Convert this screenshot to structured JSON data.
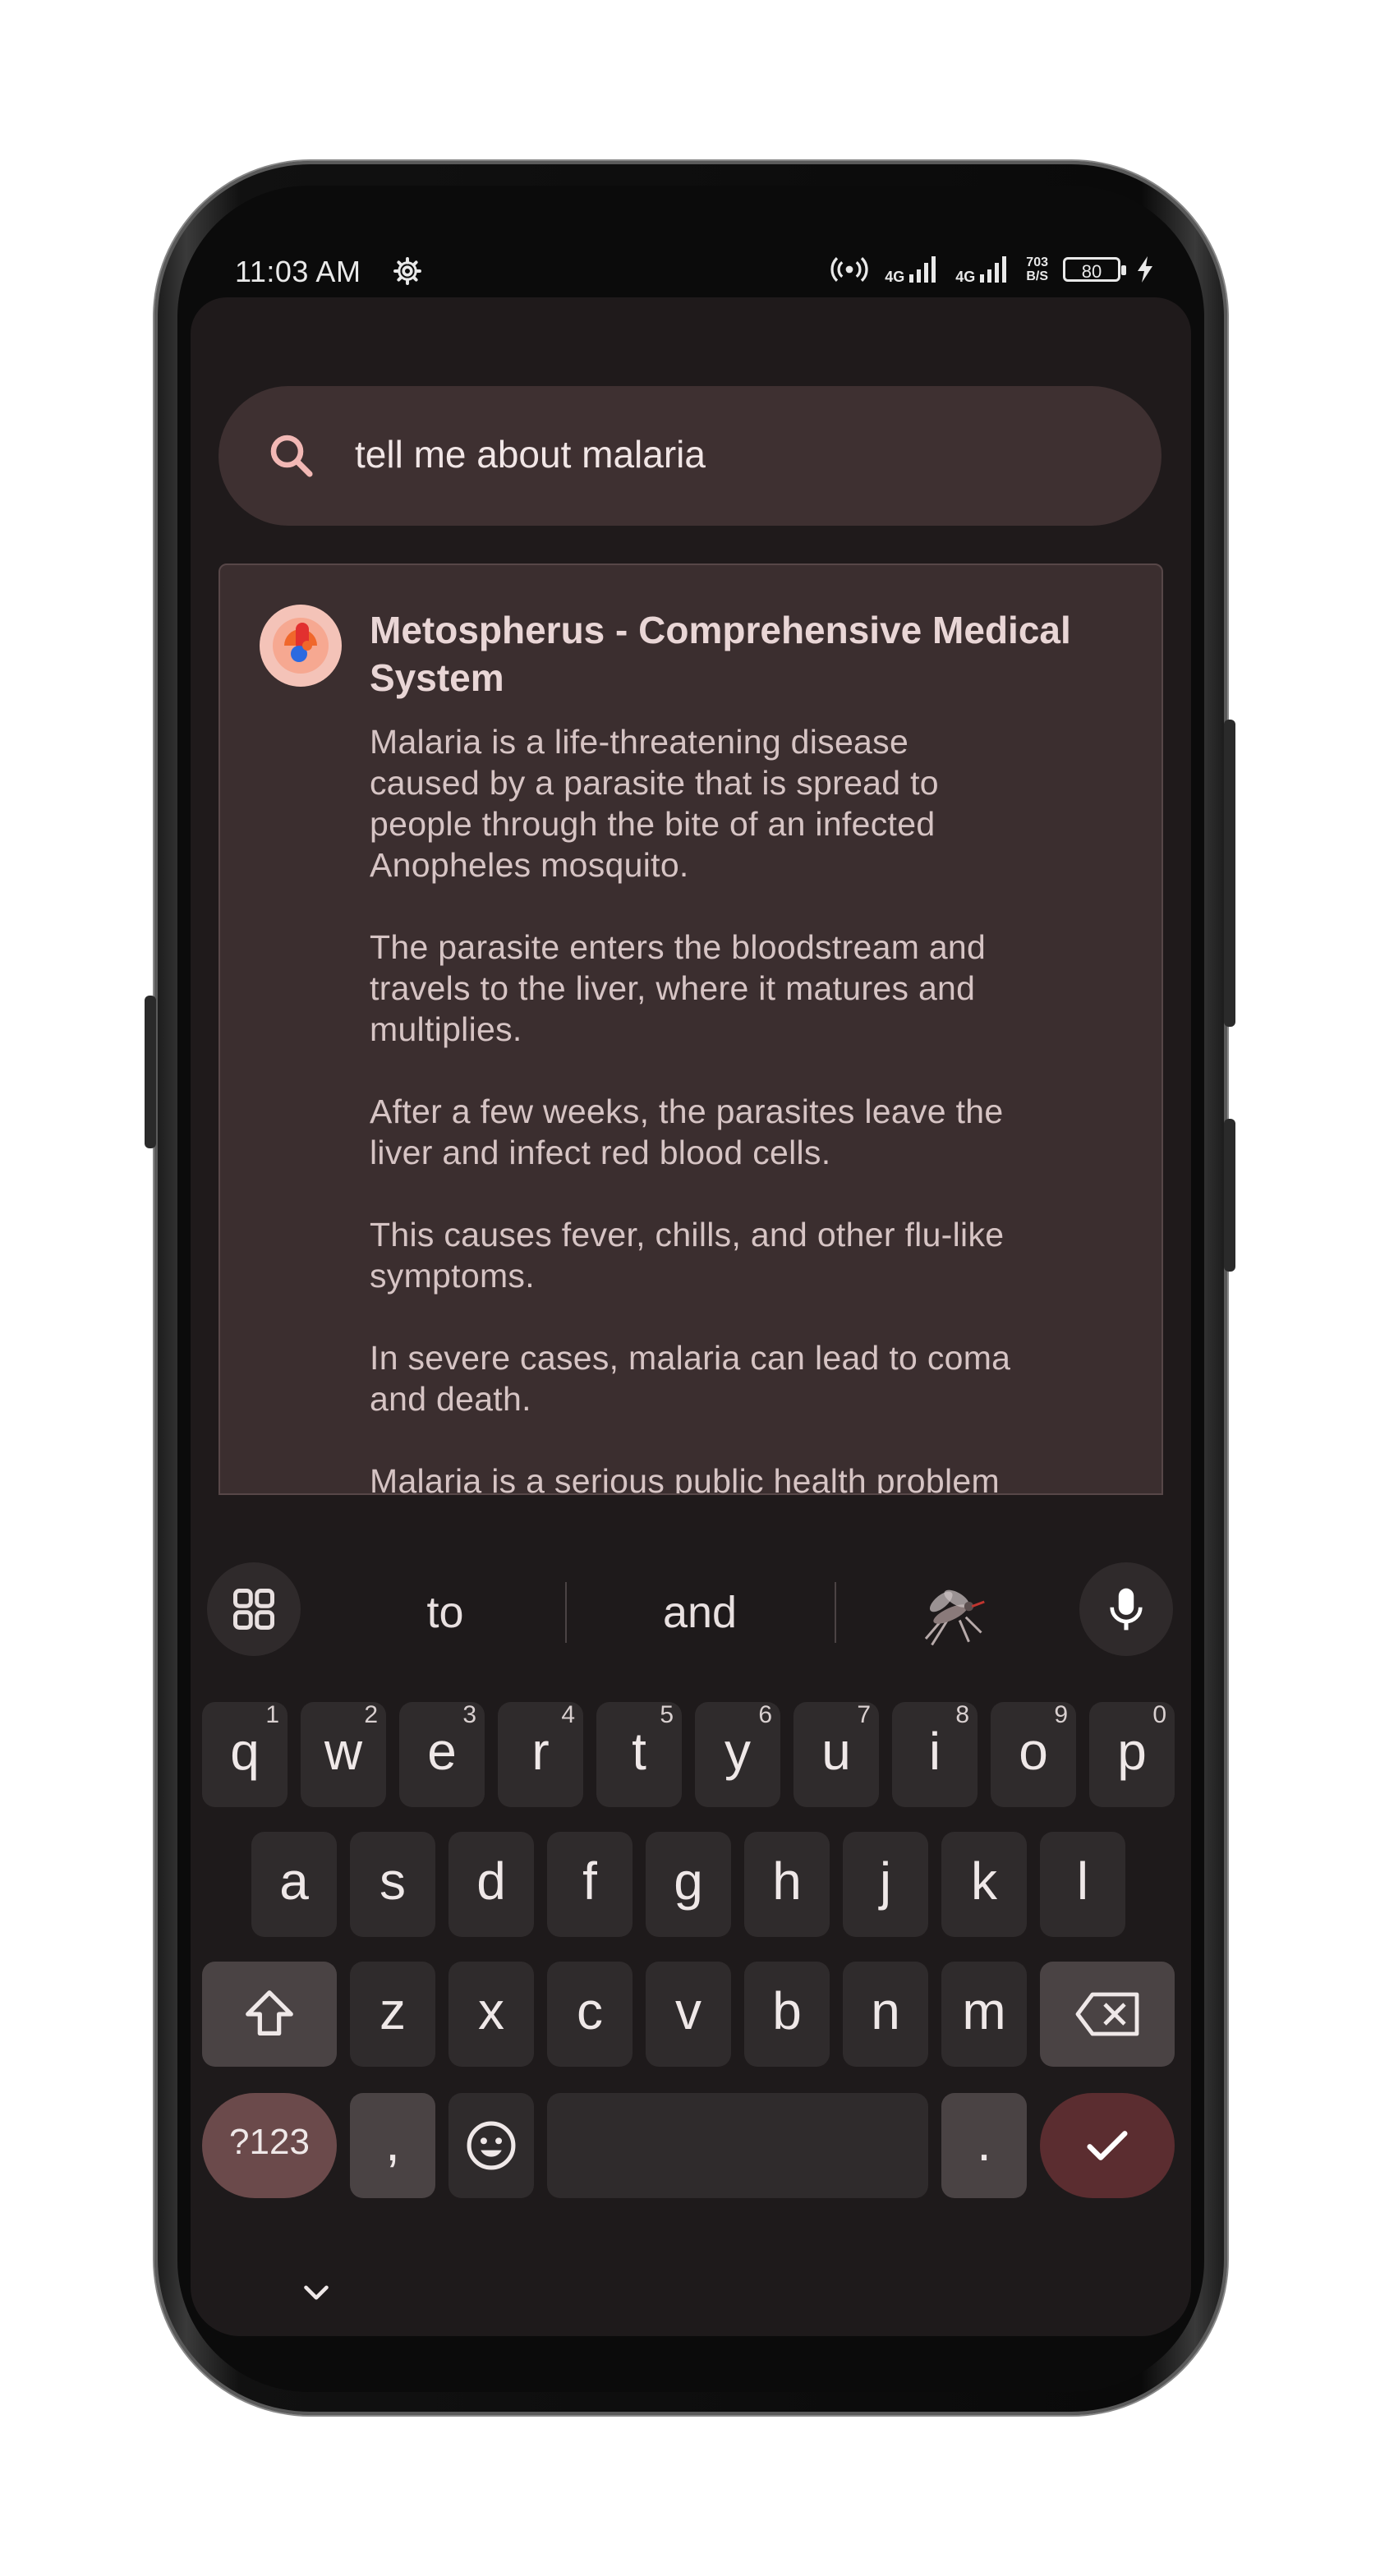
{
  "status_bar": {
    "time": "11:03 AM",
    "net1": "4G",
    "net2": "4G",
    "rate_value": "703",
    "rate_unit": "B/S",
    "battery": "80",
    "icons": [
      "gear-icon",
      "hotspot-icon",
      "signal-icon",
      "signal-icon",
      "battery-icon",
      "charging-bolt-icon"
    ]
  },
  "search": {
    "query": "tell me about malaria"
  },
  "result": {
    "title": "Metospherus - Comprehensive Medical System",
    "paragraphs": [
      "Malaria is a life-threatening disease\ncaused by a parasite that is spread to\npeople through the bite of an infected\nAnopheles mosquito.",
      "The parasite enters the bloodstream and\ntravels to the liver, where it matures and\nmultiplies.",
      "After a few weeks, the parasites leave the\nliver and infect red blood cells.",
      "This causes fever, chills, and other flu-like\nsymptoms.",
      "In severe cases, malaria can lead to coma\nand death.",
      "Malaria is a serious public health problem"
    ]
  },
  "keyboard": {
    "suggestions": [
      "to",
      "and"
    ],
    "emoji_suggestion": "mosquito-icon",
    "row1": [
      {
        "k": "q",
        "h": "1"
      },
      {
        "k": "w",
        "h": "2"
      },
      {
        "k": "e",
        "h": "3"
      },
      {
        "k": "r",
        "h": "4"
      },
      {
        "k": "t",
        "h": "5"
      },
      {
        "k": "y",
        "h": "6"
      },
      {
        "k": "u",
        "h": "7"
      },
      {
        "k": "i",
        "h": "8"
      },
      {
        "k": "o",
        "h": "9"
      },
      {
        "k": "p",
        "h": "0"
      }
    ],
    "row2": [
      "a",
      "s",
      "d",
      "f",
      "g",
      "h",
      "j",
      "k",
      "l"
    ],
    "row3": [
      "z",
      "x",
      "c",
      "v",
      "b",
      "n",
      "m"
    ],
    "symbols_label": "?123",
    "comma": ",",
    "period": "."
  },
  "colors": {
    "accent": "#5b2d30",
    "card_bg": "#3b2e2f",
    "search_bg": "#3e3031"
  }
}
